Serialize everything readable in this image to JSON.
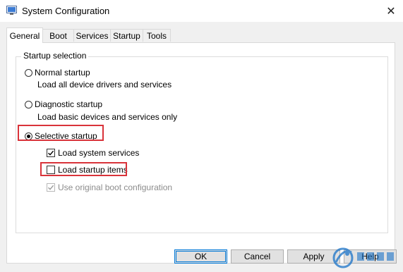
{
  "window": {
    "title": "System Configuration",
    "close_glyph": "✕"
  },
  "tabs": [
    {
      "label": "General",
      "active": true
    },
    {
      "label": "Boot",
      "active": false
    },
    {
      "label": "Services",
      "active": false
    },
    {
      "label": "Startup",
      "active": false
    },
    {
      "label": "Tools",
      "active": false
    }
  ],
  "startup_selection": {
    "group_label": "Startup selection",
    "normal": {
      "label": "Normal startup",
      "description": "Load all device drivers and services",
      "selected": false
    },
    "diagnostic": {
      "label": "Diagnostic startup",
      "description": "Load basic devices and services only",
      "selected": false
    },
    "selective": {
      "label": "Selective startup",
      "selected": true
    },
    "load_system_services": {
      "label": "Load system services",
      "checked": true
    },
    "load_startup_items": {
      "label": "Load startup items",
      "checked": false
    },
    "use_original_boot": {
      "label": "Use original boot configuration",
      "checked": true,
      "enabled": false
    }
  },
  "buttons": {
    "ok": "OK",
    "cancel": "Cancel",
    "apply": "Apply",
    "help": "Help"
  },
  "colors": {
    "highlight_box": "#d9333a",
    "dialog_bg": "#f0f0f0",
    "panel_bg": "#ffffff"
  }
}
